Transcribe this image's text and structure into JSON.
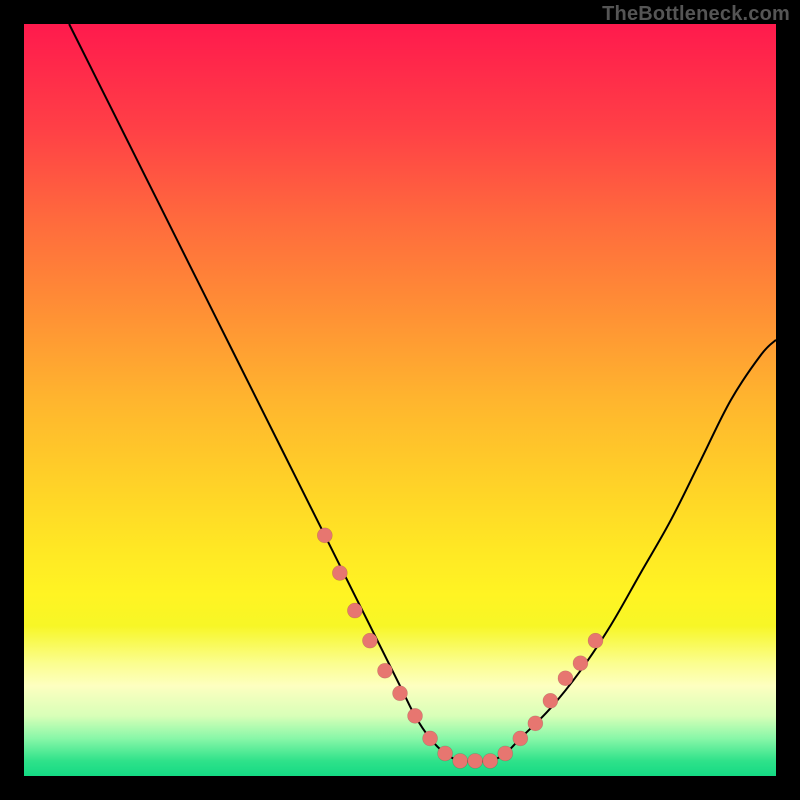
{
  "watermark": "TheBottleneck.com",
  "colors": {
    "marker": "#e77670",
    "curve": "#000000",
    "frame_bg_top": "#ff1a4d",
    "frame_bg_bottom": "#14da84",
    "page_bg": "#000000"
  },
  "chart_data": {
    "type": "line",
    "title": "",
    "xlabel": "",
    "ylabel": "",
    "xlim": [
      0,
      100
    ],
    "ylim": [
      0,
      100
    ],
    "grid": false,
    "legend": false,
    "series": [
      {
        "name": "bottleneck-curve",
        "x": [
          6,
          10,
          14,
          18,
          22,
          26,
          30,
          34,
          38,
          42,
          46,
          50,
          52,
          54,
          56,
          58,
          60,
          62,
          64,
          66,
          70,
          74,
          78,
          82,
          86,
          90,
          94,
          98,
          100
        ],
        "values": [
          100,
          92,
          84,
          76,
          68,
          60,
          52,
          44,
          36,
          28,
          20,
          12,
          8,
          5,
          3,
          2,
          2,
          2,
          3,
          5,
          9,
          14,
          20,
          27,
          34,
          42,
          50,
          56,
          58
        ]
      }
    ],
    "markers": {
      "name": "highlight-dots",
      "x": [
        40,
        42,
        44,
        46,
        48,
        50,
        52,
        54,
        56,
        58,
        60,
        62,
        64,
        66,
        68,
        70,
        72,
        74,
        76
      ],
      "values": [
        32,
        27,
        22,
        18,
        14,
        11,
        8,
        5,
        3,
        2,
        2,
        2,
        3,
        5,
        7,
        10,
        13,
        15,
        18
      ]
    }
  }
}
